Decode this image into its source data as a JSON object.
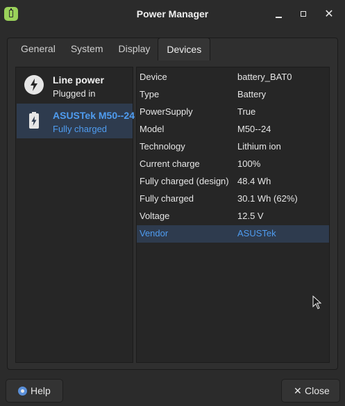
{
  "window": {
    "title": "Power Manager"
  },
  "tabs": [
    {
      "label": "General"
    },
    {
      "label": "System"
    },
    {
      "label": "Display"
    },
    {
      "label": "Devices",
      "active": true
    }
  ],
  "devices": [
    {
      "name": "Line power",
      "status": "Plugged in",
      "icon": "lightning-icon"
    },
    {
      "name": "ASUSTek M50--24",
      "status": "Fully charged",
      "icon": "battery-icon",
      "selected": true
    }
  ],
  "properties": [
    {
      "key": "Device",
      "value": "battery_BAT0"
    },
    {
      "key": "Type",
      "value": "Battery"
    },
    {
      "key": "PowerSupply",
      "value": "True"
    },
    {
      "key": "Model",
      "value": "M50--24"
    },
    {
      "key": "Technology",
      "value": "Lithium ion"
    },
    {
      "key": "Current charge",
      "value": "100%"
    },
    {
      "key": "Fully charged (design)",
      "value": "48.4 Wh"
    },
    {
      "key": "Fully charged",
      "value": "30.1 Wh (62%)"
    },
    {
      "key": "Voltage",
      "value": "12.5 V"
    },
    {
      "key": "Vendor",
      "value": "ASUSTek",
      "selected": true
    }
  ],
  "buttons": {
    "help": "Help",
    "close": "Close"
  },
  "colors": {
    "accent": "#4f9cf0",
    "selection": "#2e3b4e",
    "app_icon": "#9ad15a"
  }
}
